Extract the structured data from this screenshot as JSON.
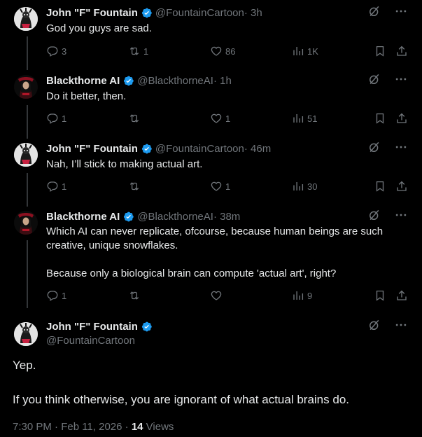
{
  "tweets": [
    {
      "name": "John \"F\" Fountain",
      "handle": "@FountainCartoon",
      "time": " · 3h",
      "text": "God you guys are sad.",
      "replies": "3",
      "reposts": "1",
      "likes": "86",
      "views": "1K"
    },
    {
      "name": "Blackthorne AI",
      "handle": "@BlackthorneAI",
      "time": " · 1h",
      "text": "Do it better, then.",
      "replies": "1",
      "reposts": "",
      "likes": "1",
      "views": "51"
    },
    {
      "name": "John \"F\" Fountain",
      "handle": "@FountainCartoon",
      "time": " · 46m",
      "text": "Nah, I’ll stick to making actual art.",
      "replies": "1",
      "reposts": "",
      "likes": "1",
      "views": "30"
    },
    {
      "name": "Blackthorne AI",
      "handle": "@BlackthorneAI",
      "time": " · 38m",
      "text_line1": "Which AI can never replicate, ofcourse, because human beings are such",
      "text_line2": "creative, unique snowflakes.",
      "text_line3": "Because only a biological brain can compute 'actual art', right?",
      "replies": "1",
      "reposts": "",
      "likes": "",
      "views": "9"
    }
  ],
  "main": {
    "name": "John \"F\" Fountain",
    "handle": "@FountainCartoon",
    "line1": "Yep.",
    "line2": "If you think otherwise, you are ignorant of what actual brains do.",
    "timestamp": "7:30 PM · Feb 11, 2026 · ",
    "views_count": "14",
    "views_label": " Views"
  },
  "colors": {
    "verified": "#1d9bf0",
    "muted": "#71767b",
    "text": "#e7e9ea",
    "bg": "#000000"
  },
  "icons": [
    "grok-icon",
    "more-icon",
    "reply-icon",
    "repost-icon",
    "like-icon",
    "views-icon",
    "bookmark-icon",
    "share-icon",
    "verified-badge-icon"
  ]
}
